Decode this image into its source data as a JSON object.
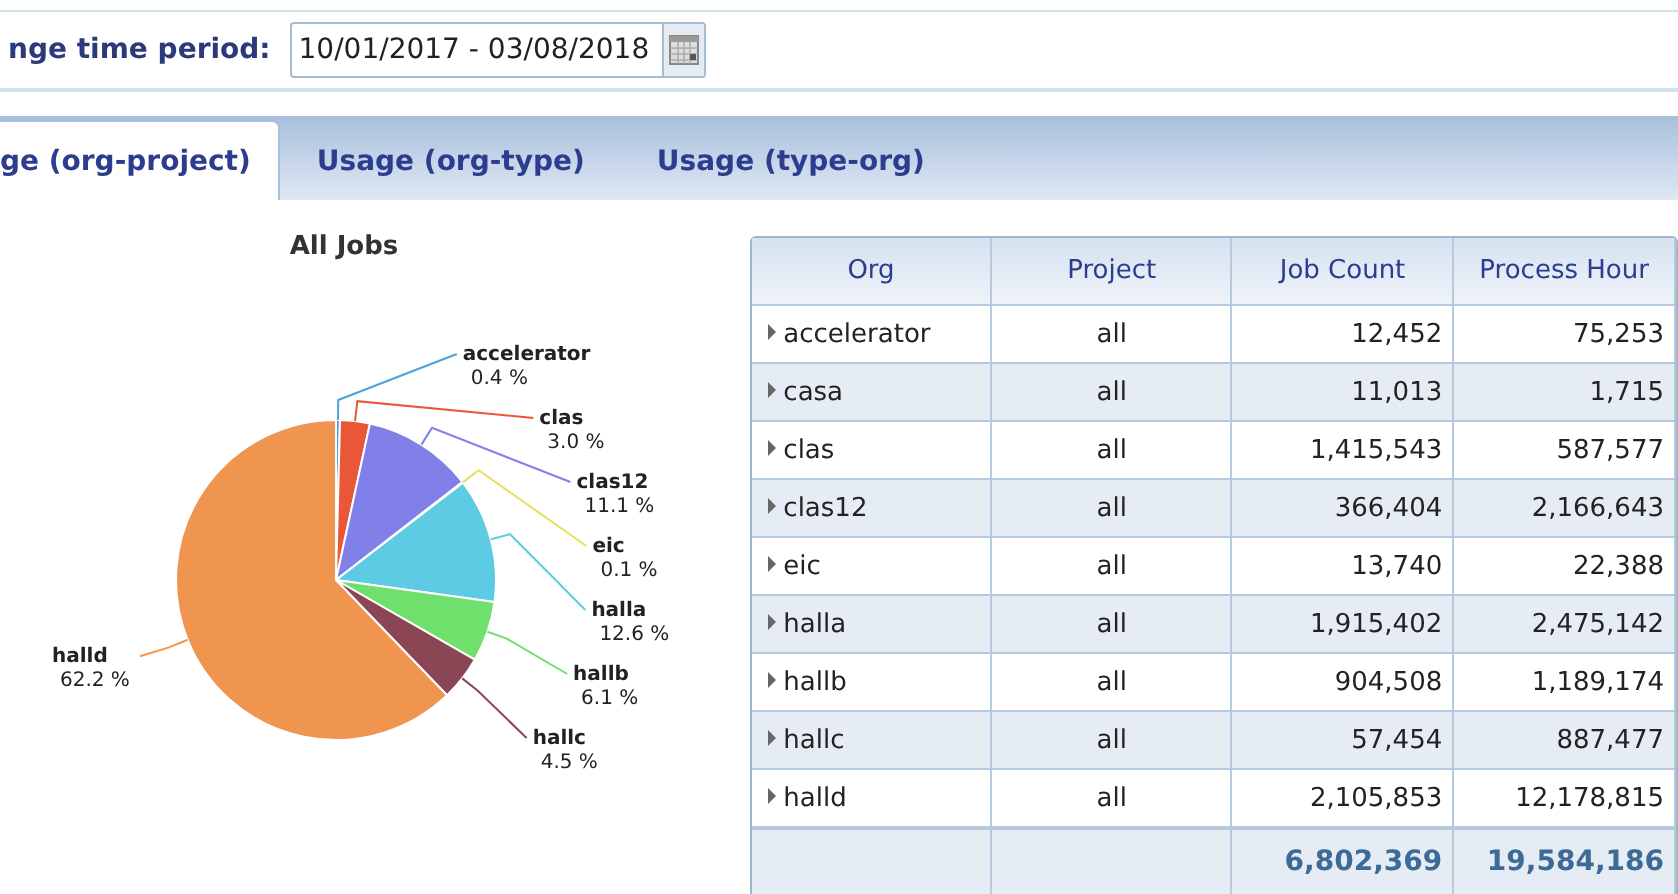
{
  "filter": {
    "label": "nge time period:",
    "value": "10/01/2017 - 03/08/2018"
  },
  "tabs": [
    {
      "label": "ge (org-project)",
      "selected": true
    },
    {
      "label": "Usage (org-type)",
      "selected": false
    },
    {
      "label": "Usage (type-org)",
      "selected": false
    }
  ],
  "chart_data": {
    "type": "pie",
    "title": "All Jobs",
    "categories": [
      "accelerator",
      "clas",
      "clas12",
      "eic",
      "halla",
      "hallb",
      "hallc",
      "halld"
    ],
    "values": [
      0.4,
      3.0,
      11.1,
      0.1,
      12.6,
      6.1,
      4.5,
      62.2
    ],
    "value_labels": [
      "0.4 %",
      "3.0 %",
      "11.1 %",
      "0.1 %",
      "12.6 %",
      "6.1 %",
      "4.5 %",
      "62.2 %"
    ]
  },
  "table": {
    "columns": [
      "Org",
      "Project",
      "Job Count",
      "Process Hour"
    ],
    "rows": [
      [
        "accelerator",
        "all",
        "12,452",
        "75,253"
      ],
      [
        "casa",
        "all",
        "11,013",
        "1,715"
      ],
      [
        "clas",
        "all",
        "1,415,543",
        "587,577"
      ],
      [
        "clas12",
        "all",
        "366,404",
        "2,166,643"
      ],
      [
        "eic",
        "all",
        "13,740",
        "22,388"
      ],
      [
        "halla",
        "all",
        "1,915,402",
        "2,475,142"
      ],
      [
        "hallb",
        "all",
        "904,508",
        "1,189,174"
      ],
      [
        "hallc",
        "all",
        "57,454",
        "887,477"
      ],
      [
        "halld",
        "all",
        "2,105,853",
        "12,178,815"
      ]
    ],
    "totals": [
      "6,802,369",
      "19,584,186"
    ]
  }
}
